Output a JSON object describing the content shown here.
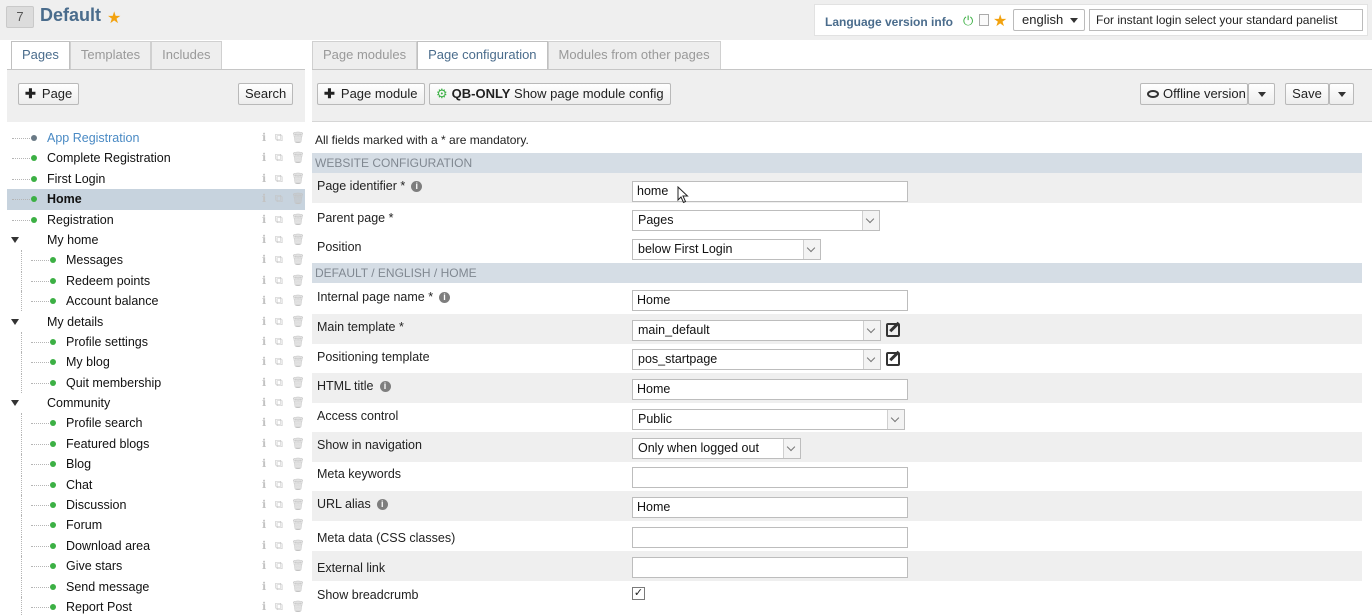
{
  "header": {
    "site_number": "7",
    "site_title": "Default",
    "language_label": "Language version info",
    "language_selected": "english",
    "instant_login_text": "For instant login select your standard panelist"
  },
  "left_tabs": [
    {
      "label": "Pages",
      "active": true
    },
    {
      "label": "Templates",
      "active": false
    },
    {
      "label": "Includes",
      "active": false
    }
  ],
  "right_tabs": [
    {
      "label": "Page modules",
      "active": false
    },
    {
      "label": "Page configuration",
      "active": true
    },
    {
      "label": "Modules from other pages",
      "active": false
    }
  ],
  "left_toolbar": {
    "add_page_label": "Page",
    "search_label": "Search"
  },
  "tree": [
    {
      "label": "App Registration",
      "level": 0,
      "dot": "grey",
      "link": true
    },
    {
      "label": "Complete Registration",
      "level": 0,
      "dot": "green"
    },
    {
      "label": "First Login",
      "level": 0,
      "dot": "green"
    },
    {
      "label": "Home",
      "level": 0,
      "dot": "green",
      "selected": true
    },
    {
      "label": "Registration",
      "level": 0,
      "dot": "green"
    },
    {
      "label": "My home",
      "level": 0,
      "expanded": true
    },
    {
      "label": "Messages",
      "level": 1,
      "dot": "green"
    },
    {
      "label": "Redeem points",
      "level": 1,
      "dot": "green"
    },
    {
      "label": "Account balance",
      "level": 1,
      "dot": "green"
    },
    {
      "label": "My details",
      "level": 0,
      "expanded": true
    },
    {
      "label": "Profile settings",
      "level": 1,
      "dot": "green"
    },
    {
      "label": "My blog",
      "level": 1,
      "dot": "green"
    },
    {
      "label": "Quit membership",
      "level": 1,
      "dot": "green"
    },
    {
      "label": "Community",
      "level": 0,
      "expanded": true
    },
    {
      "label": "Profile search",
      "level": 1,
      "dot": "green"
    },
    {
      "label": "Featured blogs",
      "level": 1,
      "dot": "green"
    },
    {
      "label": "Blog",
      "level": 1,
      "dot": "green"
    },
    {
      "label": "Chat",
      "level": 1,
      "dot": "green"
    },
    {
      "label": "Discussion",
      "level": 1,
      "dot": "green"
    },
    {
      "label": "Forum",
      "level": 1,
      "dot": "green"
    },
    {
      "label": "Download area",
      "level": 1,
      "dot": "green"
    },
    {
      "label": "Give stars",
      "level": 1,
      "dot": "green"
    },
    {
      "label": "Send message",
      "level": 1,
      "dot": "green"
    },
    {
      "label": "Report Post",
      "level": 1,
      "dot": "green"
    }
  ],
  "right_toolbar": {
    "page_module_label": "Page module",
    "qb_label": "QB-ONLY",
    "show_config_label": "Show page module config",
    "offline_label": "Offline version",
    "save_label": "Save"
  },
  "form": {
    "mandatory_note": "All fields marked with a * are mandatory.",
    "section_website": "WEBSITE CONFIGURATION",
    "section_default": "DEFAULT / ENGLISH / HOME",
    "page_identifier_label": "Page identifier *",
    "page_identifier_value": "home",
    "parent_page_label": "Parent page *",
    "parent_page_value": "Pages",
    "position_label": "Position",
    "position_value": "below First Login",
    "internal_name_label": "Internal page name *",
    "internal_name_value": "Home",
    "main_template_label": "Main template *",
    "main_template_value": "main_default",
    "positioning_template_label": "Positioning template",
    "positioning_template_value": "pos_startpage",
    "html_title_label": "HTML title",
    "html_title_value": "Home",
    "access_control_label": "Access control",
    "access_control_value": "Public",
    "show_nav_label": "Show in navigation",
    "show_nav_value": "Only when logged out",
    "meta_keywords_label": "Meta keywords",
    "meta_keywords_value": "",
    "url_alias_label": "URL alias",
    "url_alias_value": "Home",
    "meta_data_label": "Meta data (CSS classes)",
    "meta_data_value": "",
    "external_link_label": "External link",
    "external_link_value": "",
    "show_breadcrumb_label": "Show breadcrumb",
    "show_breadcrumb_checked": true
  }
}
